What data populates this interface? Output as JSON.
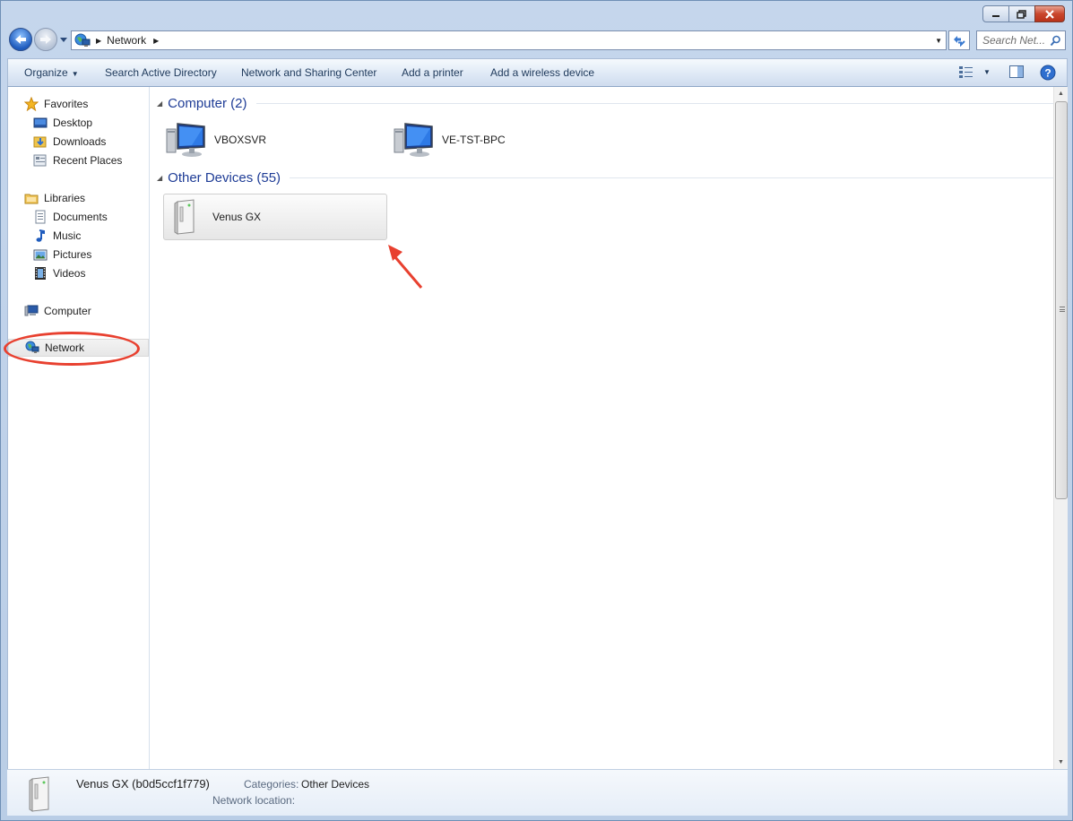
{
  "window": {
    "caption": {
      "minimize_icon": "minimize-icon",
      "maximize_icon": "restore-icon",
      "close_icon": "close-icon"
    }
  },
  "nav": {
    "breadcrumb": [
      "Network"
    ],
    "search_placeholder": "Search Net..."
  },
  "toolbar": {
    "organize": "Organize",
    "search_ad": "Search Active Directory",
    "network_sharing": "Network and Sharing Center",
    "add_printer": "Add a printer",
    "add_wireless": "Add a wireless device"
  },
  "navpane": {
    "favorites": "Favorites",
    "desktop": "Desktop",
    "downloads": "Downloads",
    "recent_places": "Recent Places",
    "libraries": "Libraries",
    "documents": "Documents",
    "music": "Music",
    "pictures": "Pictures",
    "videos": "Videos",
    "computer": "Computer",
    "network": "Network"
  },
  "content": {
    "computer_group": "Computer (2)",
    "computers": [
      "VBOXSVR",
      "VE-TST-BPC"
    ],
    "devices_group": "Other Devices (55)",
    "devices": [
      "Venus GX"
    ]
  },
  "details": {
    "name": "Venus GX (b0d5ccf1f779)",
    "categories_label": "Categories:",
    "categories_value": "Other Devices",
    "location_label": "Network location:"
  },
  "colors": {
    "annotation": "#e8402f",
    "group_title": "#1e3c96",
    "toolbar_text": "#1e395b"
  }
}
